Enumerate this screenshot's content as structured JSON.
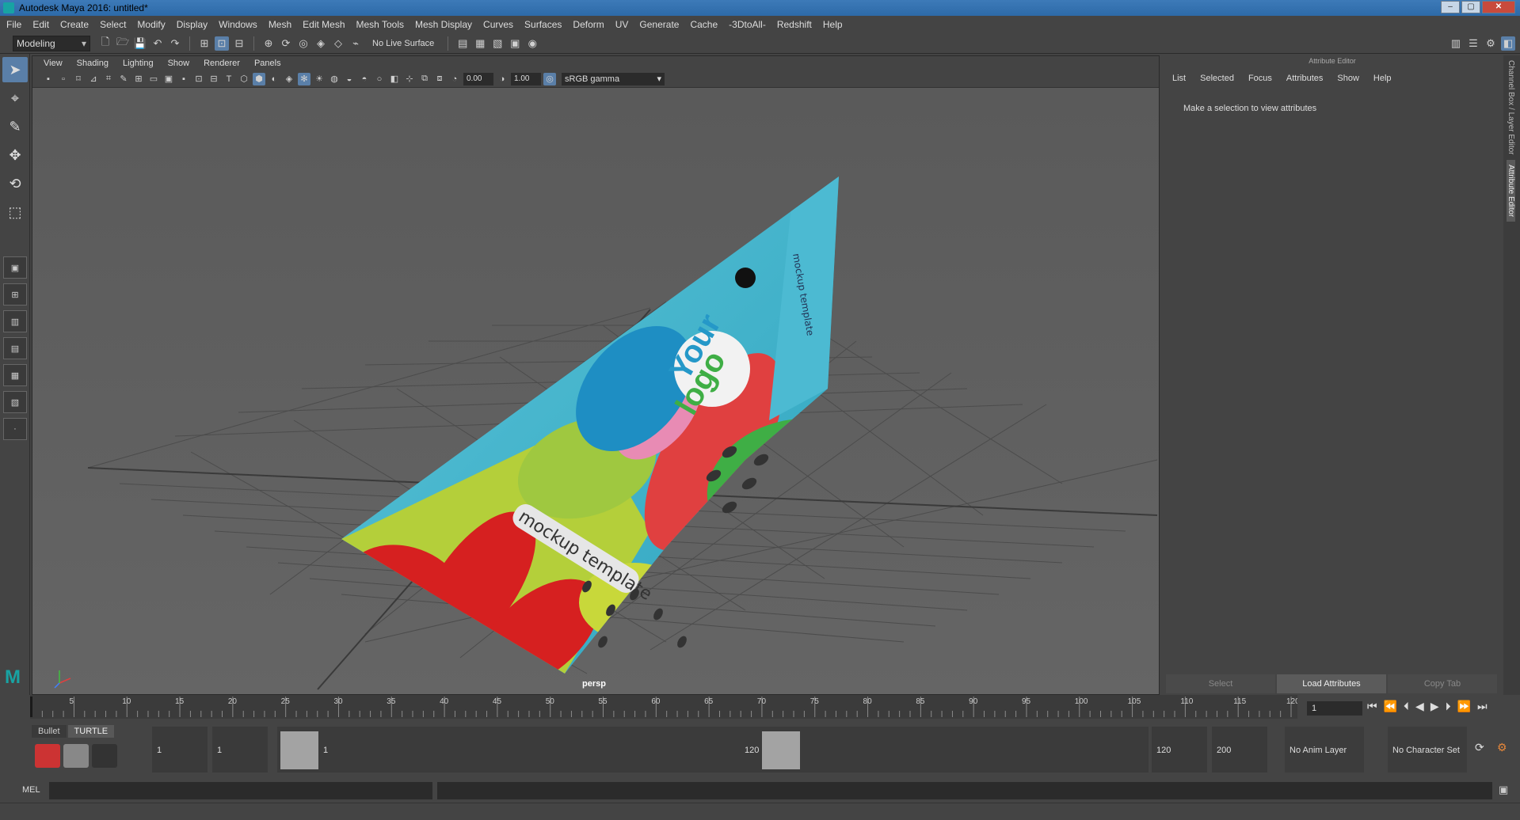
{
  "window": {
    "title": "Autodesk Maya 2016: untitled*"
  },
  "menus": [
    "File",
    "Edit",
    "Create",
    "Select",
    "Modify",
    "Display",
    "Windows",
    "Mesh",
    "Edit Mesh",
    "Mesh Tools",
    "Mesh Display",
    "Curves",
    "Surfaces",
    "Deform",
    "UV",
    "Generate",
    "Cache",
    "-3DtoAll-",
    "Redshift",
    "Help"
  ],
  "shelf": {
    "mode": "Modeling",
    "live_surface": "No Live Surface"
  },
  "viewport": {
    "menus": [
      "View",
      "Shading",
      "Lighting",
      "Show",
      "Renderer",
      "Panels"
    ],
    "exposure": "0.00",
    "gamma": "1.00",
    "colorspace": "sRGB gamma",
    "camera_label": "persp"
  },
  "product": {
    "logo_line1": "Your",
    "logo_line2": "logo",
    "label": "mockup template",
    "side_label": "mockup template"
  },
  "attribute_editor": {
    "header": "Attribute Editor",
    "menus": [
      "List",
      "Selected",
      "Focus",
      "Attributes",
      "Show",
      "Help"
    ],
    "message": "Make a selection to view attributes",
    "buttons": [
      "Select",
      "Load Attributes",
      "Copy Tab"
    ]
  },
  "side_tabs": [
    "Channel Box / Layer Editor",
    "Attribute Editor"
  ],
  "timeline": {
    "ticks": [
      "5",
      "10",
      "15",
      "20",
      "25",
      "30",
      "35",
      "40",
      "45",
      "50",
      "55",
      "60",
      "65",
      "70",
      "75",
      "80",
      "85",
      "90",
      "95",
      "100",
      "105",
      "110",
      "115",
      "120"
    ],
    "start_marker": "1",
    "current_frame": "1"
  },
  "range": {
    "shelf_tabs": [
      "Bullet",
      "TURTLE"
    ],
    "start_time": "1",
    "playback_start": "1",
    "slider_start": "1",
    "slider_end": "120",
    "playback_end": "120",
    "end_time": "200",
    "anim_layer": "No Anim Layer",
    "character_set": "No Character Set"
  },
  "command_line": {
    "label": "MEL"
  }
}
